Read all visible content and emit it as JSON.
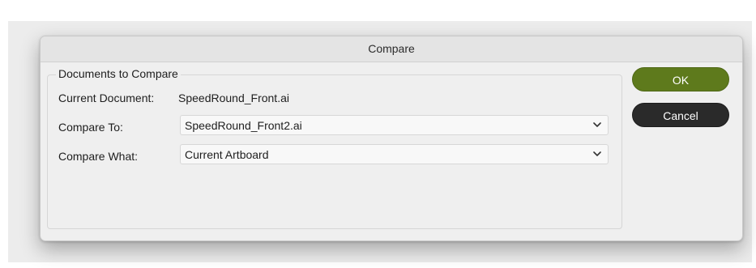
{
  "dialog": {
    "title": "Compare",
    "group_title": "Documents to Compare",
    "current_document": {
      "label": "Current Document:",
      "value": "SpeedRound_Front.ai"
    },
    "compare_to": {
      "label": "Compare To:",
      "selected": "SpeedRound_Front2.ai"
    },
    "compare_what": {
      "label": "Compare What:",
      "selected": "Current Artboard"
    },
    "buttons": {
      "ok": "OK",
      "cancel": "Cancel"
    }
  },
  "colors": {
    "ok_button": "#5e7a1c",
    "cancel_button": "#2a2a2a",
    "dialog_background": "#efefef"
  },
  "icons": {
    "dropdown": "chevron-down-icon"
  }
}
